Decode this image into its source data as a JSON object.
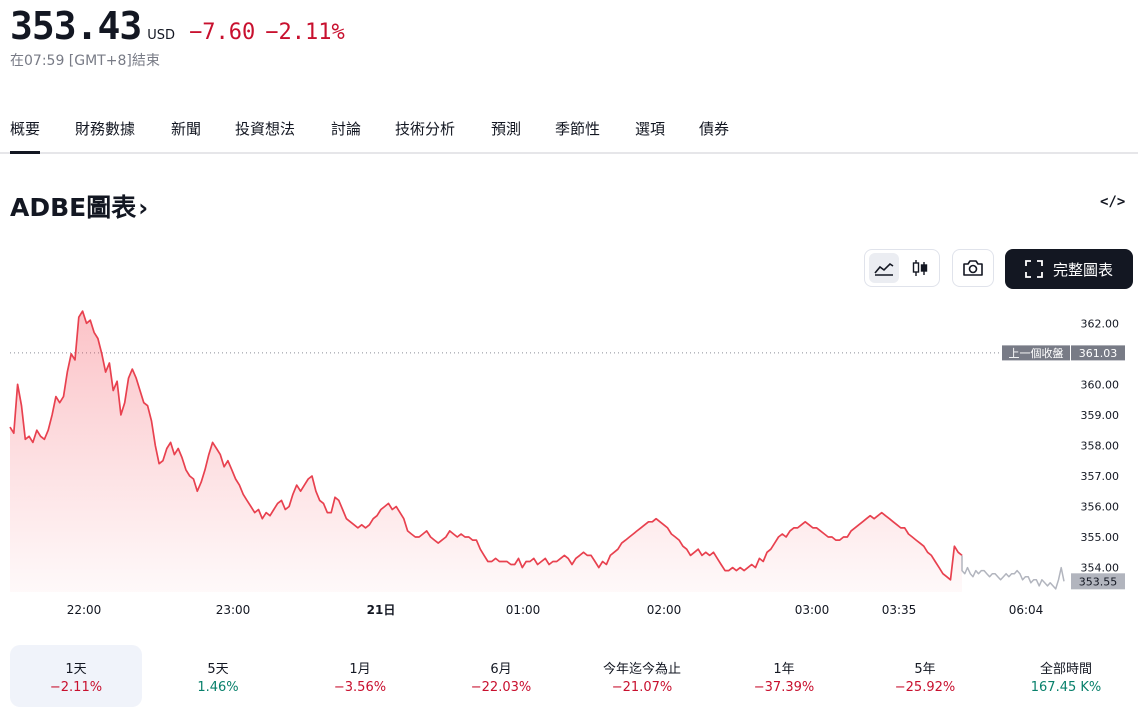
{
  "quote": {
    "price": "353.43",
    "currency": "USD",
    "change": "−7.60",
    "change_pct": "−2.11%",
    "time_note": "在07:59 [GMT+8]結束"
  },
  "tabs": [
    "概要",
    "財務數據",
    "新聞",
    "投資想法",
    "討論",
    "技術分析",
    "預測",
    "季節性",
    "選項",
    "債券"
  ],
  "chart_header": {
    "title": "ADBE圖表",
    "chevron": "›",
    "embed": "</>"
  },
  "toolbar": {
    "full_chart_label": "完整圖表"
  },
  "colors": {
    "down": "#c8102e",
    "up": "#08806b",
    "line": "#e8414f",
    "extended": "#b2b5be"
  },
  "chart_data": {
    "type": "area",
    "y_ticks": [
      "362.00",
      "361.00",
      "360.00",
      "359.00",
      "358.00",
      "357.00",
      "356.00",
      "355.00",
      "354.00"
    ],
    "ylim": [
      353.2,
      362.5
    ],
    "x_ticks": [
      "22:00",
      "23:00",
      "21日",
      "01:00",
      "02:00",
      "03:00",
      "03:35",
      "06:04"
    ],
    "prev_close": {
      "label": "上一個收盤",
      "value": "361.03"
    },
    "last_price_label": "353.55",
    "series": [
      {
        "session": "regular",
        "values": [
          358.6,
          358.4,
          360.0,
          359.3,
          358.2,
          358.3,
          358.1,
          358.5,
          358.3,
          358.2,
          358.5,
          359.0,
          359.6,
          359.4,
          359.6,
          360.4,
          361.0,
          360.8,
          362.2,
          362.4,
          362.0,
          362.1,
          361.7,
          361.5,
          361.0,
          360.4,
          360.7,
          359.8,
          360.1,
          359.0,
          359.4,
          360.2,
          360.5,
          360.2,
          359.8,
          359.4,
          359.3,
          358.8,
          358.0,
          357.4,
          357.5,
          357.9,
          358.1,
          357.7,
          357.9,
          357.6,
          357.2,
          357.0,
          356.9,
          356.5,
          356.8,
          357.2,
          357.7,
          358.1,
          357.9,
          357.7,
          357.3,
          357.5,
          357.2,
          356.9,
          356.7,
          356.4,
          356.2,
          356.0,
          355.8,
          355.9,
          355.6,
          355.8,
          355.7,
          355.9,
          356.1,
          356.2,
          355.9,
          356.0,
          356.4,
          356.7,
          356.5,
          356.7,
          356.9,
          357.0,
          356.5,
          356.2,
          356.1,
          355.8,
          355.8,
          356.3,
          356.2,
          355.9,
          355.6,
          355.5,
          355.4,
          355.3,
          355.4,
          355.3,
          355.4,
          355.6,
          355.7,
          355.9,
          356.0,
          356.1,
          355.9,
          356.0,
          355.8,
          355.6,
          355.2,
          355.1,
          355.0,
          355.0,
          355.1,
          355.2,
          355.0,
          354.9,
          354.8,
          354.9,
          355.0,
          355.2,
          355.1,
          355.0,
          355.1,
          355.0,
          355.0,
          354.9,
          354.9,
          354.6,
          354.4,
          354.2,
          354.2,
          354.3,
          354.2,
          354.2,
          354.2,
          354.1,
          354.1,
          354.3,
          354.0,
          354.2,
          354.2,
          354.3,
          354.1,
          354.2,
          354.3,
          354.1,
          354.2,
          354.2,
          354.3,
          354.4,
          354.3,
          354.1,
          354.3,
          354.4,
          354.5,
          354.4,
          354.4,
          354.2,
          354.0,
          354.2,
          354.1,
          354.4,
          354.5,
          354.6,
          354.8,
          354.9,
          355.0,
          355.1,
          355.2,
          355.3,
          355.4,
          355.5,
          355.5,
          355.6,
          355.5,
          355.4,
          355.3,
          355.1,
          355.0,
          354.9,
          354.7,
          354.6,
          354.4,
          354.5,
          354.6,
          354.4,
          354.5,
          354.4,
          354.5,
          354.3,
          354.1,
          353.9,
          353.9,
          354.0,
          353.9,
          354.0,
          353.9,
          354.0,
          354.1,
          354.0,
          354.3,
          354.2,
          354.5,
          354.6,
          354.8,
          355.0,
          355.1,
          355.0,
          355.2,
          355.3,
          355.3,
          355.4,
          355.5,
          355.4,
          355.3,
          355.3,
          355.2,
          355.1,
          355.0,
          355.0,
          354.9,
          354.9,
          355.0,
          355.0,
          355.2,
          355.3,
          355.4,
          355.5,
          355.6,
          355.7,
          355.6,
          355.7,
          355.8,
          355.7,
          355.6,
          355.5,
          355.4,
          355.3,
          355.3,
          355.1,
          355.0,
          354.9,
          354.8,
          354.7,
          354.5,
          354.4,
          354.2,
          354.0,
          353.8,
          353.7,
          353.6,
          354.7,
          354.5,
          354.4
        ]
      },
      {
        "session": "extended",
        "values": [
          353.9,
          353.8,
          354.0,
          353.8,
          353.7,
          353.9,
          353.8,
          353.9,
          353.9,
          353.8,
          353.7,
          353.8,
          353.8,
          353.7,
          353.6,
          353.7,
          353.8,
          353.7,
          353.8,
          353.8,
          353.9,
          353.8,
          353.6,
          353.7,
          353.7,
          353.5,
          353.6,
          353.6,
          353.4,
          353.6,
          353.5,
          353.4,
          353.5,
          353.4,
          353.3,
          353.6,
          354.0,
          353.55
        ]
      }
    ]
  },
  "periods": [
    {
      "label": "1天",
      "value": "−2.11%",
      "dir": "neg"
    },
    {
      "label": "5天",
      "value": "1.46%",
      "dir": "pos"
    },
    {
      "label": "1月",
      "value": "−3.56%",
      "dir": "neg"
    },
    {
      "label": "6月",
      "value": "−22.03%",
      "dir": "neg"
    },
    {
      "label": "今年迄今為止",
      "value": "−21.07%",
      "dir": "neg"
    },
    {
      "label": "1年",
      "value": "−37.39%",
      "dir": "neg"
    },
    {
      "label": "5年",
      "value": "−25.92%",
      "dir": "neg"
    },
    {
      "label": "全部時間",
      "value": "167.45 K%",
      "dir": "pos"
    }
  ]
}
